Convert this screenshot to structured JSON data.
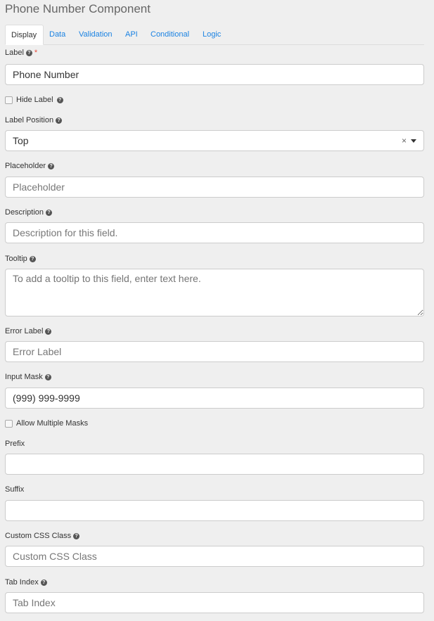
{
  "title": "Phone Number Component",
  "tabs": [
    "Display",
    "Data",
    "Validation",
    "API",
    "Conditional",
    "Logic"
  ],
  "fields": {
    "label": {
      "label": "Label",
      "required": "*",
      "value": "Phone Number"
    },
    "hide_label": {
      "label": "Hide Label",
      "checked": false
    },
    "label_position": {
      "label": "Label Position",
      "value": "Top",
      "clear": "×"
    },
    "placeholder": {
      "label": "Placeholder",
      "placeholder": "Placeholder"
    },
    "description": {
      "label": "Description",
      "placeholder": "Description for this field."
    },
    "tooltip": {
      "label": "Tooltip",
      "placeholder": "To add a tooltip to this field, enter text here."
    },
    "error_label": {
      "label": "Error Label",
      "placeholder": "Error Label"
    },
    "input_mask": {
      "label": "Input Mask",
      "value": "(999) 999-9999"
    },
    "allow_multiple_masks": {
      "label": "Allow Multiple Masks",
      "checked": false
    },
    "prefix": {
      "label": "Prefix",
      "value": ""
    },
    "suffix": {
      "label": "Suffix",
      "value": ""
    },
    "custom_css": {
      "label": "Custom CSS Class",
      "placeholder": "Custom CSS Class"
    },
    "tab_index": {
      "label": "Tab Index",
      "placeholder": "Tab Index"
    }
  },
  "help_glyph": "?",
  "colors": {
    "link": "#1a82e2",
    "required": "#e74c3c",
    "background": "#efefef"
  }
}
